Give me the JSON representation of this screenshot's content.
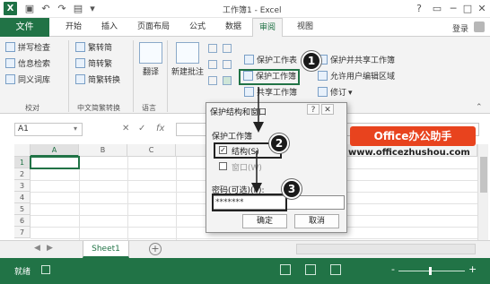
{
  "titlebar": {
    "app_icon": "X",
    "title": "工作簿1 - Excel",
    "qat_icons": [
      "save-icon",
      "undo-icon",
      "redo-icon",
      "open-icon",
      "dropdown-icon"
    ],
    "window_buttons": [
      "?",
      "□",
      "─",
      "□",
      "✕"
    ]
  },
  "tabs": {
    "file": "文件",
    "items": [
      "开始",
      "插入",
      "页面布局",
      "公式",
      "数据",
      "审阅",
      "视图"
    ],
    "active": "审阅",
    "login": "登录"
  },
  "ribbon": {
    "proofing": {
      "items": [
        "拼写检查",
        "信息检索",
        "同义词库"
      ],
      "label": "校对"
    },
    "chinese": {
      "items": [
        "繁转简",
        "简转繁",
        "简繁转换"
      ],
      "label": "中文简繁转换"
    },
    "language": {
      "translate": "翻译",
      "label": "语言"
    },
    "comments": {
      "new_comment": "新建批注",
      "label": "批"
    },
    "protect": {
      "items": [
        "保护工作表",
        "保护工作簿",
        "共享工作簿"
      ],
      "right_items": [
        "保护并共享工作簿",
        "允许用户编辑区域",
        "修订"
      ]
    }
  },
  "formula_bar": {
    "name_box": "A1",
    "icons": [
      "✕",
      "✓",
      "fx"
    ]
  },
  "grid": {
    "columns": [
      "A",
      "B",
      "C"
    ],
    "rows": [
      "1",
      "2",
      "3",
      "4",
      "5",
      "6",
      "7"
    ]
  },
  "dialog": {
    "title": "保护结构和窗口",
    "help": "?",
    "close": "✕",
    "section": "保护工作簿",
    "structure_label": "结构(S)",
    "window_label": "窗口(W)",
    "password_label": "密码(可选)(P):",
    "password_value": "*******",
    "ok": "确定",
    "cancel": "取消"
  },
  "sheets": {
    "active": "Sheet1",
    "add": "+"
  },
  "statusbar": {
    "text": "就绪",
    "zoom_minus": "-",
    "zoom_plus": "+"
  },
  "callouts": [
    "1",
    "2",
    "3"
  ],
  "watermark": {
    "badge": "Office办公助手",
    "url": "www.officezhushou.com"
  }
}
